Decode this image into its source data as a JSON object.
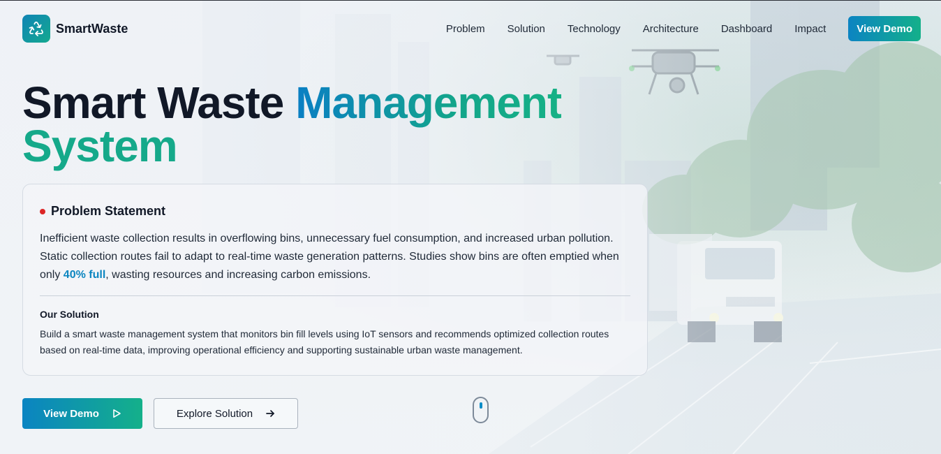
{
  "brand": {
    "name": "SmartWaste",
    "logo_icon": "recycle-icon"
  },
  "nav": {
    "links": [
      "Problem",
      "Solution",
      "Technology",
      "Architecture",
      "Dashboard",
      "Impact"
    ],
    "cta_label": "View Demo"
  },
  "hero": {
    "title_part1": "Smart Waste",
    "title_part2": "Management",
    "title_part3": "System"
  },
  "problem": {
    "heading": "Problem Statement",
    "text_before": "Inefficient waste collection results in overflowing bins, unnecessary fuel consumption, and increased urban pollution. Static collection routes fail to adapt to real-time waste generation patterns. Studies show bins are often emptied when only ",
    "highlight": "40% full",
    "text_after": ", wasting resources and increasing carbon emissions."
  },
  "solution": {
    "heading": "Our Solution",
    "text": "Build a smart waste management system that monitors bin fill levels using IoT sensors and recommends optimized collection routes based on real-time data, improving operational efficiency and supporting sustainable urban waste management."
  },
  "actions": {
    "primary_label": "View Demo",
    "primary_icon": "play-icon",
    "secondary_label": "Explore Solution",
    "secondary_icon": "arrow-right-icon"
  },
  "scroll_indicator_icon": "mouse-scroll-icon",
  "colors": {
    "accent_blue": "#0b84c2",
    "accent_green": "#14b08a",
    "alert_red": "#dc2626",
    "text_dark": "#111827"
  }
}
